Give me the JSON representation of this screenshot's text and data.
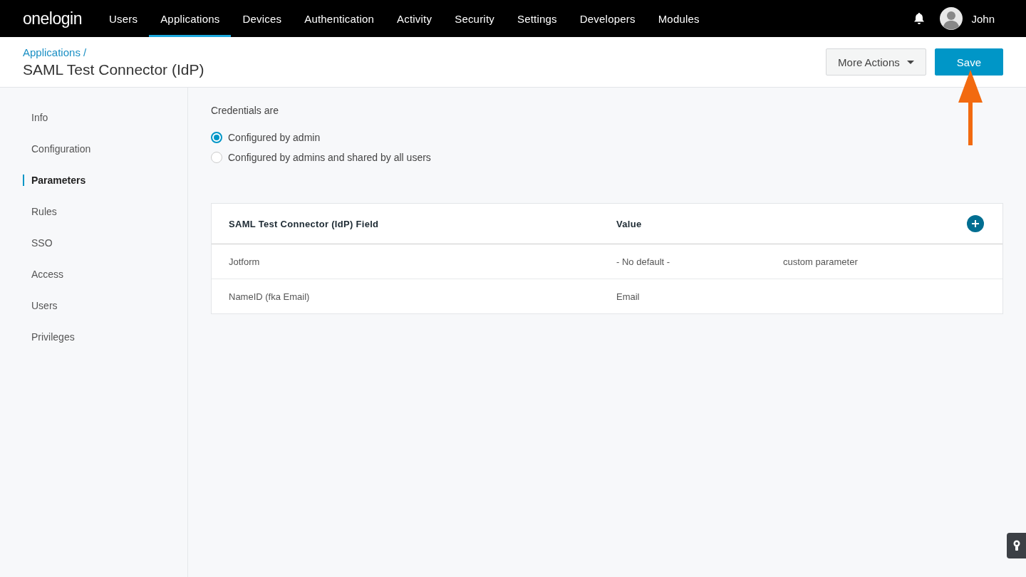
{
  "brand": "onelogin",
  "nav": [
    {
      "label": "Users",
      "selected": false
    },
    {
      "label": "Applications",
      "selected": true
    },
    {
      "label": "Devices",
      "selected": false
    },
    {
      "label": "Authentication",
      "selected": false
    },
    {
      "label": "Activity",
      "selected": false
    },
    {
      "label": "Security",
      "selected": false
    },
    {
      "label": "Settings",
      "selected": false
    },
    {
      "label": "Developers",
      "selected": false
    },
    {
      "label": "Modules",
      "selected": false
    }
  ],
  "user": {
    "name": "John"
  },
  "header": {
    "breadcrumb": "Applications /",
    "title": "SAML Test Connector (IdP)",
    "buttons": [
      {
        "kind": "dropdown",
        "label": "More Actions"
      },
      {
        "kind": "primary",
        "label": "Save"
      }
    ]
  },
  "sidebar": {
    "items": [
      {
        "label": "Info",
        "selected": false
      },
      {
        "label": "Configuration",
        "selected": false
      },
      {
        "label": "Parameters",
        "selected": true
      },
      {
        "label": "Rules",
        "selected": false
      },
      {
        "label": "SSO",
        "selected": false
      },
      {
        "label": "Access",
        "selected": false
      },
      {
        "label": "Users",
        "selected": false
      },
      {
        "label": "Privileges",
        "selected": false
      }
    ]
  },
  "credentials": {
    "label": "Credentials are",
    "options": [
      {
        "label": "Configured by admin",
        "selected": true
      },
      {
        "label": "Configured by admins and shared by all users",
        "selected": false
      }
    ]
  },
  "table": {
    "columns": [
      "SAML Test Connector (IdP) Field",
      "Value"
    ],
    "rows": [
      {
        "field": "Jotform",
        "value": "- No default -",
        "note": "custom parameter"
      },
      {
        "field": "NameID (fka Email)",
        "value": "Email"
      }
    ]
  }
}
